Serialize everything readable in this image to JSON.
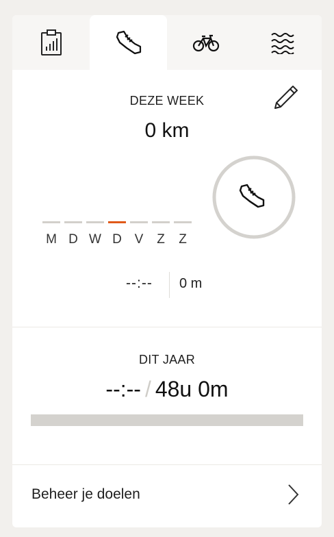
{
  "tabs": [
    {
      "name": "summary",
      "icon": "clipboard-chart-icon",
      "active": false
    },
    {
      "name": "running",
      "icon": "running-shoe-icon",
      "active": true
    },
    {
      "name": "cycling",
      "icon": "bicycle-icon",
      "active": false
    },
    {
      "name": "swimming",
      "icon": "waves-icon",
      "active": false
    }
  ],
  "week": {
    "title": "DEZE WEEK",
    "distance": "0 km",
    "days": [
      "M",
      "D",
      "W",
      "D",
      "V",
      "Z",
      "Z"
    ],
    "today_index": 3,
    "time": "--:--",
    "meters": "0 m",
    "ring_icon": "running-shoe-icon"
  },
  "year": {
    "title": "DIT JAAR",
    "current": "--:--",
    "separator": "/",
    "goal": "48u 0m",
    "progress": 0
  },
  "manage": {
    "label": "Beheer je doelen",
    "icon": "chevron-right-icon"
  },
  "colors": {
    "accent": "#e05a1a",
    "track": "#d4d2ce",
    "background": "#f2f0ed"
  }
}
